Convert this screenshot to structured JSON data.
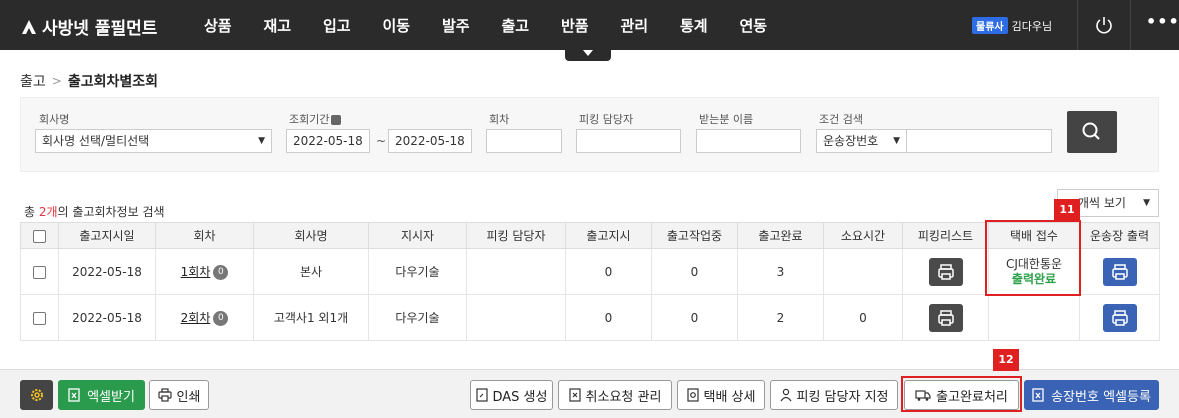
{
  "app": {
    "brand": "사방넷 풀필먼트",
    "menu": [
      "상품",
      "재고",
      "입고",
      "이동",
      "발주",
      "출고",
      "반품",
      "관리",
      "통계",
      "연동"
    ],
    "user_badge": "물류사",
    "user_name": "김다우님"
  },
  "breadcrumb": [
    "출고",
    "출고회차별조회"
  ],
  "search": {
    "company_label": "회사명",
    "company_value": "회사명 선택/멀티선택",
    "period_label": "조회기간",
    "date_from": "2022-05-18",
    "date_sep": "~",
    "date_to": "2022-05-18",
    "round_label": "회차",
    "round_value": "",
    "picker_label": "피킹 담당자",
    "picker_value": "",
    "recipient_label": "받는분 이름",
    "recipient_value": "",
    "cond_label": "조건 검색",
    "cond_select": "운송장번호",
    "cond_value": ""
  },
  "summary": {
    "prefix": "총 ",
    "count": "2개",
    "suffix": "의 출고회차정보 검색"
  },
  "per_page": "개씩 보기",
  "table": {
    "headers": [
      "출고지시일",
      "회차",
      "회사명",
      "지시자",
      "피킹 담당자",
      "출고지시",
      "출고작업중",
      "출고완료",
      "소요시간",
      "피킹리스트",
      "택배 접수",
      "운송장 출력"
    ],
    "rows": [
      {
        "date": "2022-05-18",
        "round": "1회차",
        "round_badge": "0",
        "company": "본사",
        "instructor": "다우기술",
        "picker": "",
        "ordered": "0",
        "working": "0",
        "done": "3",
        "duration": "",
        "courier": "CJ대한통운",
        "courier_status": "출력완료"
      },
      {
        "date": "2022-05-18",
        "round": "2회차",
        "round_badge": "0",
        "company": "고객사1 외1개",
        "instructor": "다우기술",
        "picker": "",
        "ordered": "0",
        "working": "0",
        "done": "2",
        "duration": "0",
        "courier": "",
        "courier_status": ""
      }
    ]
  },
  "markers": {
    "m11": "11",
    "m12": "12"
  },
  "bottom": {
    "excel": "엑셀받기",
    "print": "인쇄",
    "das": "DAS 생성",
    "cancel": "취소요청 관리",
    "courier_detail": "택배 상세",
    "assign_picker": "피킹 담당자 지정",
    "complete": "출고완료처리",
    "invoice_excel": "송장번호 엑셀등록"
  },
  "colors": {
    "nav": "#2b2b2b",
    "accent_red": "#e02020",
    "green": "#2a9a4d",
    "blue": "#3a63b5"
  }
}
